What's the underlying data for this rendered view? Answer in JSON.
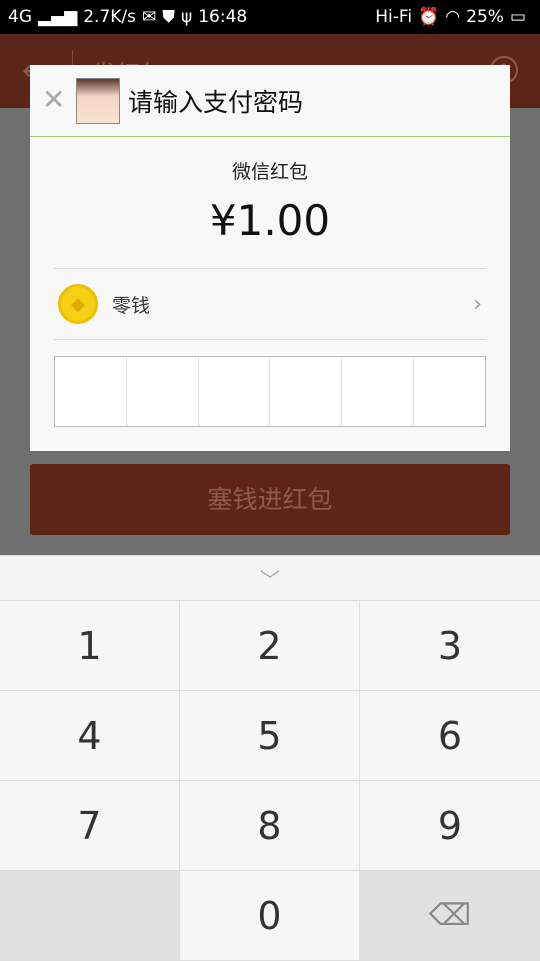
{
  "status": {
    "network": "4G",
    "speed": "2.7K/s",
    "time": "16:48",
    "hifi": "Hi-Fi",
    "battery": "25%"
  },
  "appbar": {
    "title": "发红包"
  },
  "dialog": {
    "title": "请输入支付密码",
    "subtitle": "微信红包",
    "amount": "¥1.00",
    "payment_method": "零钱",
    "password_length": 6
  },
  "button": {
    "label": "塞钱进红包"
  },
  "keypad": {
    "keys": [
      "1",
      "2",
      "3",
      "4",
      "5",
      "6",
      "7",
      "8",
      "9",
      "",
      "0",
      "⌫"
    ]
  }
}
